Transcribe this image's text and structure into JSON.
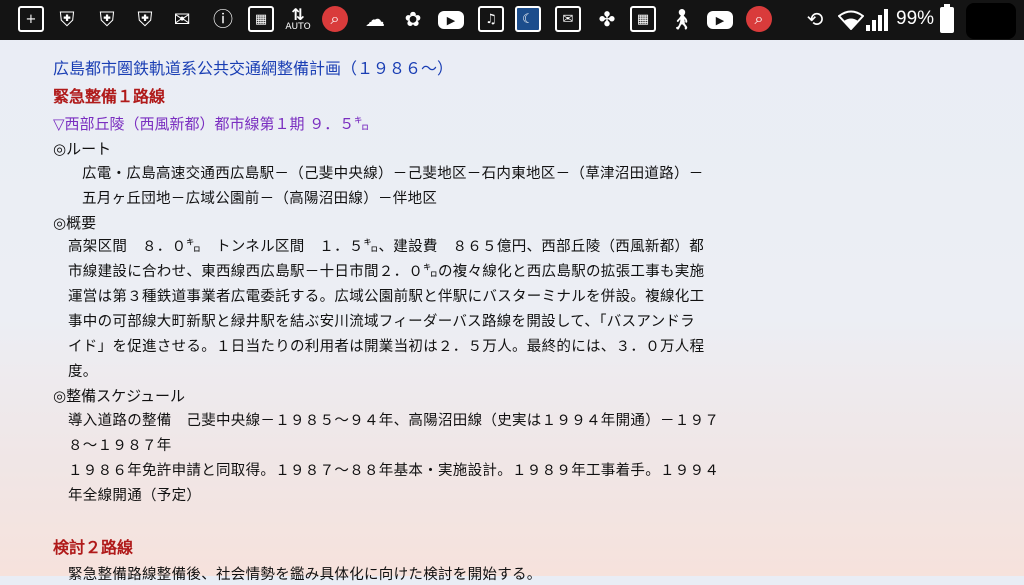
{
  "status_bar": {
    "icons": [
      "add-box-icon",
      "shield-icon",
      "shield-icon",
      "shield-icon",
      "mail-icon",
      "info-badge-icon",
      "app-grid-icon",
      "auto-brightness-icon",
      "search-red-icon",
      "cloud-icon",
      "settings-flower-icon",
      "youtube-icon",
      "music-folder-icon",
      "moon-app-icon",
      "mail-icon",
      "flower-app-icon",
      "app-grid-icon",
      "walking-icon",
      "youtube-icon",
      "search-red-icon",
      "phone-rotate-icon",
      "wifi-icon",
      "signal-icon"
    ],
    "auto_label": "AUTO",
    "battery_percent": "99%"
  },
  "document": {
    "title": "広島都市圏鉄軌道系公共交通網整備計画（１９８６～）",
    "section1_heading": "緊急整備１路線",
    "subheading": "▽西部丘陵（西風新都）都市線第１期 ９．５㌔",
    "route_label": "◎ルート",
    "route_lines": [
      "広電・広島高速交通西広島駅－（己斐中央線）－己斐地区－石内東地区－（草津沼田道路）－",
      "五月ヶ丘団地－広域公園前－（高陽沼田線）－伴地区"
    ],
    "overview_label": "◎概要",
    "overview_lines": [
      "高架区間　８．０㌔　トンネル区間　１．５㌔、建設費　８６５億円、西部丘陵（西風新都）都",
      "市線建設に合わせ、東西線西広島駅－十日市間２．０㌔の複々線化と西広島駅の拡張工事も実施",
      "運営は第３種鉄道事業者広電委託する。広域公園前駅と伴駅にバスターミナルを併設。複線化工",
      "事中の可部線大町新駅と緑井駅を結ぶ安川流域フィーダーバス路線を開設して、「バスアンドラ",
      "イド」を促進させる。１日当たりの利用者は開業当初は２．５万人。最終的には、３．０万人程",
      "度。"
    ],
    "schedule_label": "◎整備スケジュール",
    "schedule_lines": [
      "導入道路の整備　己斐中央線－１９８５～９４年、高陽沼田線（史実は１９９４年開通）－１９７",
      "８～１９８７年",
      "１９８６年免許申請と同取得。１９８７～８８年基本・実施設計。１９８９年工事着手。１９９４",
      "年全線開通（予定）"
    ],
    "section2_heading": "検討２路線",
    "section2_line": "緊急整備路線整備後、社会情勢を鑑み具体化に向けた検討を開始する。"
  }
}
